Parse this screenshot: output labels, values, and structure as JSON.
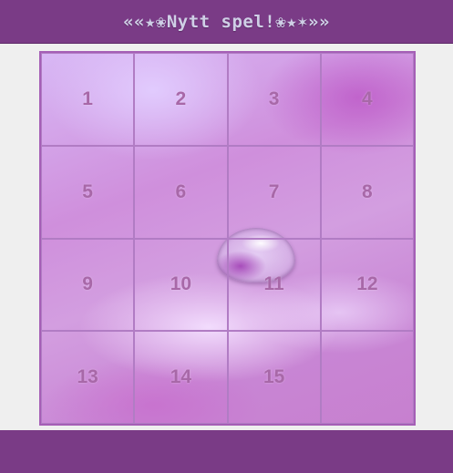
{
  "header": {
    "new_game_label": "««★❀Nytt spel!❀★✶»»"
  },
  "board": {
    "tiles": [
      {
        "label": "1"
      },
      {
        "label": "2"
      },
      {
        "label": "3"
      },
      {
        "label": "4"
      },
      {
        "label": "5"
      },
      {
        "label": "6"
      },
      {
        "label": "7"
      },
      {
        "label": "8"
      },
      {
        "label": "9"
      },
      {
        "label": "10"
      },
      {
        "label": "11"
      },
      {
        "label": "12"
      },
      {
        "label": "13"
      },
      {
        "label": "14"
      },
      {
        "label": "15"
      },
      {
        "label": ""
      }
    ]
  },
  "colors": {
    "bar": "#7a3b86",
    "tile_number": "#a868a8",
    "background": "#efefef"
  }
}
